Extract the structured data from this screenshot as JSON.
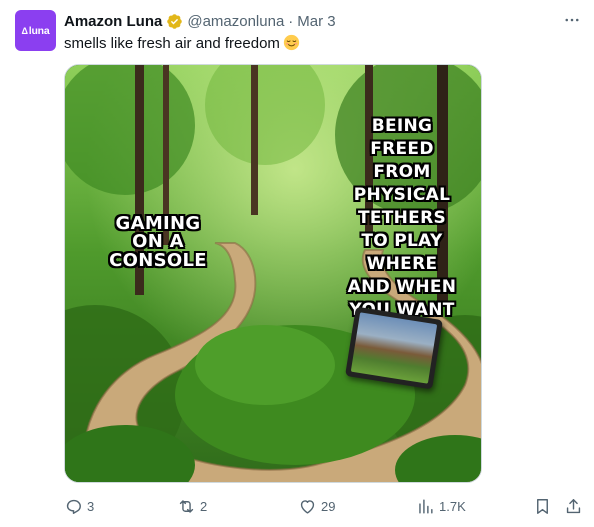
{
  "avatar": {
    "text": "luna",
    "glyph": "Δ",
    "color": "#8b3ff0"
  },
  "author": {
    "display_name": "Amazon Luna",
    "handle": "@amazonluna",
    "separator": "·",
    "date": "Mar 3",
    "verified_badge": "gold"
  },
  "tweet": {
    "text": "smells like fresh air and freedom",
    "emoji": "relieved-face"
  },
  "meme": {
    "left_caption": "GAMING ON A CONSOLE",
    "right_caption": "BEING FREED FROM PHYSICAL TETHERS TO PLAY WHERE AND WHEN YOU WANT"
  },
  "actions": {
    "replies": "3",
    "reposts": "2",
    "likes": "29",
    "views": "1.7K"
  },
  "colors": {
    "text": "#0f1419",
    "muted": "#536471",
    "verified_gold": "#e2b719",
    "border": "#cfd9de"
  }
}
